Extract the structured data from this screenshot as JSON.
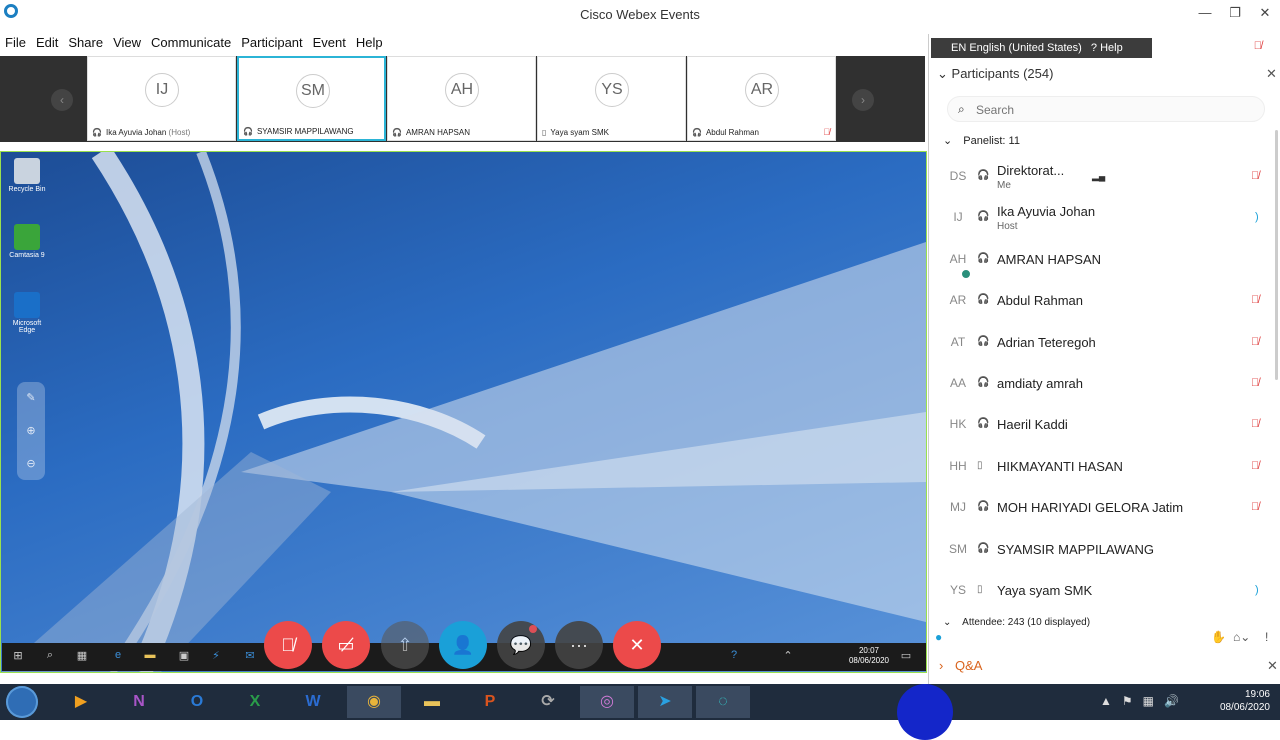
{
  "window": {
    "title": "Cisco Webex Events",
    "minimize": "—",
    "restore": "❐",
    "close": "✕"
  },
  "menu": [
    "File",
    "Edit",
    "Share",
    "View",
    "Communicate",
    "Participant",
    "Event",
    "Help"
  ],
  "strip": {
    "tiles": [
      {
        "initials": "IJ",
        "name": "Ika Ayuvia Johan",
        "role": "(Host)",
        "device": "audio-icon"
      },
      {
        "initials": "SM",
        "name": "SYAMSIR MAPPILAWANG",
        "role": "",
        "device": "audio-icon",
        "active": true
      },
      {
        "initials": "AH",
        "name": "AMRAN HAPSAN",
        "role": "",
        "device": "audio-icon"
      },
      {
        "initials": "YS",
        "name": "Yaya syam SMK",
        "role": "",
        "device": "phone-icon"
      },
      {
        "initials": "AR",
        "name": "Abdul Rahman",
        "role": "",
        "device": "audio-icon",
        "muted": true
      }
    ]
  },
  "desktop": {
    "icons": [
      "Recycle Bin",
      "Camtasia 9",
      "Microsoft Edge"
    ],
    "clock_time": "20:07",
    "clock_date": "08/06/2020"
  },
  "lang": {
    "label": "EN English (United States)",
    "help": "Help"
  },
  "participants": {
    "header": "Participants (254)",
    "search_placeholder": "Search",
    "panelist_label": "Panelist: 11",
    "attendee_label": "Attendee: 243 (10 displayed)",
    "panelists": [
      {
        "initials": "DS",
        "name": "Direktorat...",
        "sub": "Me",
        "muted": true,
        "bars": true
      },
      {
        "initials": "IJ",
        "name": "Ika Ayuvia Johan",
        "sub": "Host",
        "muted": false
      },
      {
        "initials": "AH",
        "name": "AMRAN HAPSAN",
        "sub": "",
        "muted": false,
        "online": true
      },
      {
        "initials": "AR",
        "name": "Abdul Rahman",
        "sub": "",
        "muted": true
      },
      {
        "initials": "AT",
        "name": "Adrian Teteregoh",
        "sub": "",
        "muted": true
      },
      {
        "initials": "AA",
        "name": "amdiaty amrah",
        "sub": "",
        "muted": true
      },
      {
        "initials": "HK",
        "name": "Haeril Kaddi",
        "sub": "",
        "muted": true
      },
      {
        "initials": "HH",
        "name": "HIKMAYANTI HASAN",
        "sub": "",
        "muted": true,
        "phone": true
      },
      {
        "initials": "MJ",
        "name": "MOH HARIYADI GELORA Jatim",
        "sub": "",
        "muted": true
      },
      {
        "initials": "SM",
        "name": "SYAMSIR MAPPILAWANG",
        "sub": "",
        "muted": false
      },
      {
        "initials": "YS",
        "name": "Yaya syam SMK",
        "sub": "",
        "muted": false,
        "phone": true
      }
    ]
  },
  "qa": {
    "label": "Q&A"
  },
  "taskbar": {
    "time": "19:06",
    "date": "08/06/2020"
  },
  "colors": {
    "accent": "#1aa0d8",
    "mute_red": "#ec4a4a",
    "active_tile": "#2bb4d6",
    "qa_orange": "#d9641e"
  }
}
